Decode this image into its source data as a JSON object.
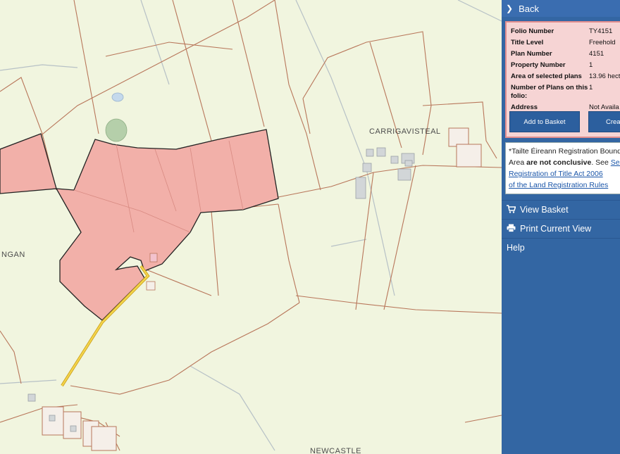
{
  "map": {
    "places": [
      "CARRIGAVISTEAL",
      "NGAN",
      "NEWCASTLE"
    ]
  },
  "panel": {
    "back_label": "Back",
    "info": [
      {
        "label": "Folio Number",
        "value": "TY4151"
      },
      {
        "label": "Title Level",
        "value": "Freehold"
      },
      {
        "label": "Plan Number",
        "value": "4151"
      },
      {
        "label": "Property Number",
        "value": "1"
      },
      {
        "label": "Area of selected plans",
        "value": "13.96 hect"
      },
      {
        "label": "Number of Plans on this folio:",
        "value": "1"
      },
      {
        "label": "Address",
        "value": "Not Availa"
      }
    ],
    "add_to_basket": "Add to Basket",
    "create_label": "Crea",
    "note": {
      "line1": "*Tailte Éireann Registration Bound",
      "line2_pre": "Area ",
      "line2_bold": "are not conclusive",
      "line2_post": ". See ",
      "line2_link": "Sec",
      "line3": "Registration of Title Act 2006",
      "line4": "of the Land Registration Rules"
    },
    "menu": [
      {
        "label": "View Basket",
        "icon": "cart-icon"
      },
      {
        "label": "Print Current View",
        "icon": "print-icon"
      },
      {
        "label": "Help",
        "icon": ""
      }
    ]
  }
}
